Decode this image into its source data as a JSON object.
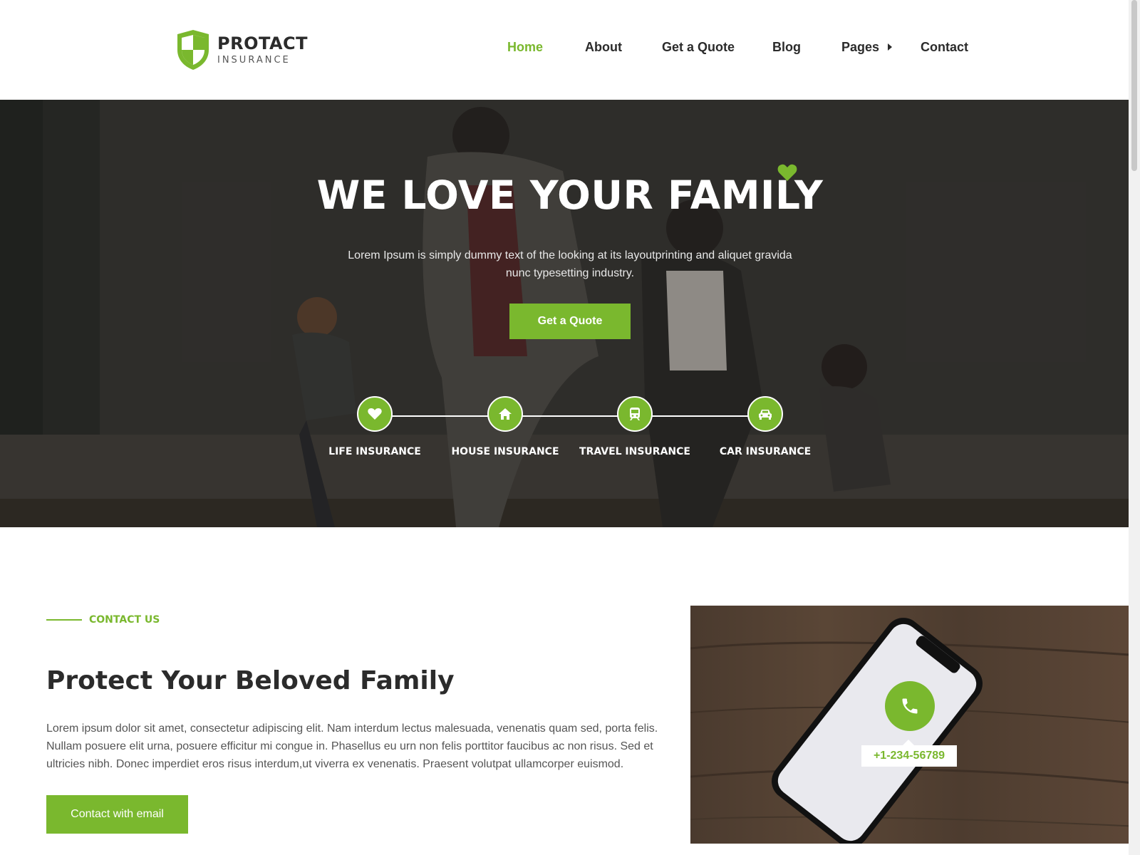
{
  "brand": {
    "name": "PROTACT",
    "tagline": "INSURANCE"
  },
  "colors": {
    "accent": "#7ab82e",
    "text_dark": "#2b2b2b",
    "text_muted": "#555555",
    "white": "#ffffff"
  },
  "nav": {
    "items": [
      {
        "label": "Home",
        "active": true
      },
      {
        "label": "About",
        "active": false
      },
      {
        "label": "Get a Quote",
        "active": false
      },
      {
        "label": "Blog",
        "active": false
      },
      {
        "label": "Pages",
        "active": false,
        "has_submenu": true
      },
      {
        "label": "Contact",
        "active": false
      }
    ]
  },
  "hero": {
    "title": "WE LOVE YOUR FAMILY",
    "text": "Lorem Ipsum is simply dummy text of the looking at its layoutprinting and aliquet gravida nunc typesetting industry.",
    "button_label": "Get a Quote",
    "insurances": [
      {
        "label": "LIFE INSURANCE",
        "icon": "heart-icon"
      },
      {
        "label": "HOUSE INSURANCE",
        "icon": "house-icon"
      },
      {
        "label": "TRAVEL INSURANCE",
        "icon": "train-icon"
      },
      {
        "label": "CAR INSURANCE",
        "icon": "car-icon"
      }
    ]
  },
  "contact": {
    "tag": "CONTACT US",
    "title": "Protect Your Beloved Family",
    "text": "Lorem ipsum dolor sit amet, consectetur adipiscing elit. Nam interdum lectus malesuada, venenatis quam sed, porta felis. Nullam posuere elit urna, posuere efficitur mi congue in. Phasellus eu urn non felis porttitor faucibus ac non risus. Sed et ultricies nibh. Donec imperdiet eros risus interdum,ut viverra ex venenatis. Praesent volutpat ullamcorper euismod.",
    "button_label": "Contact with email",
    "phone": "+1-234-56789"
  }
}
